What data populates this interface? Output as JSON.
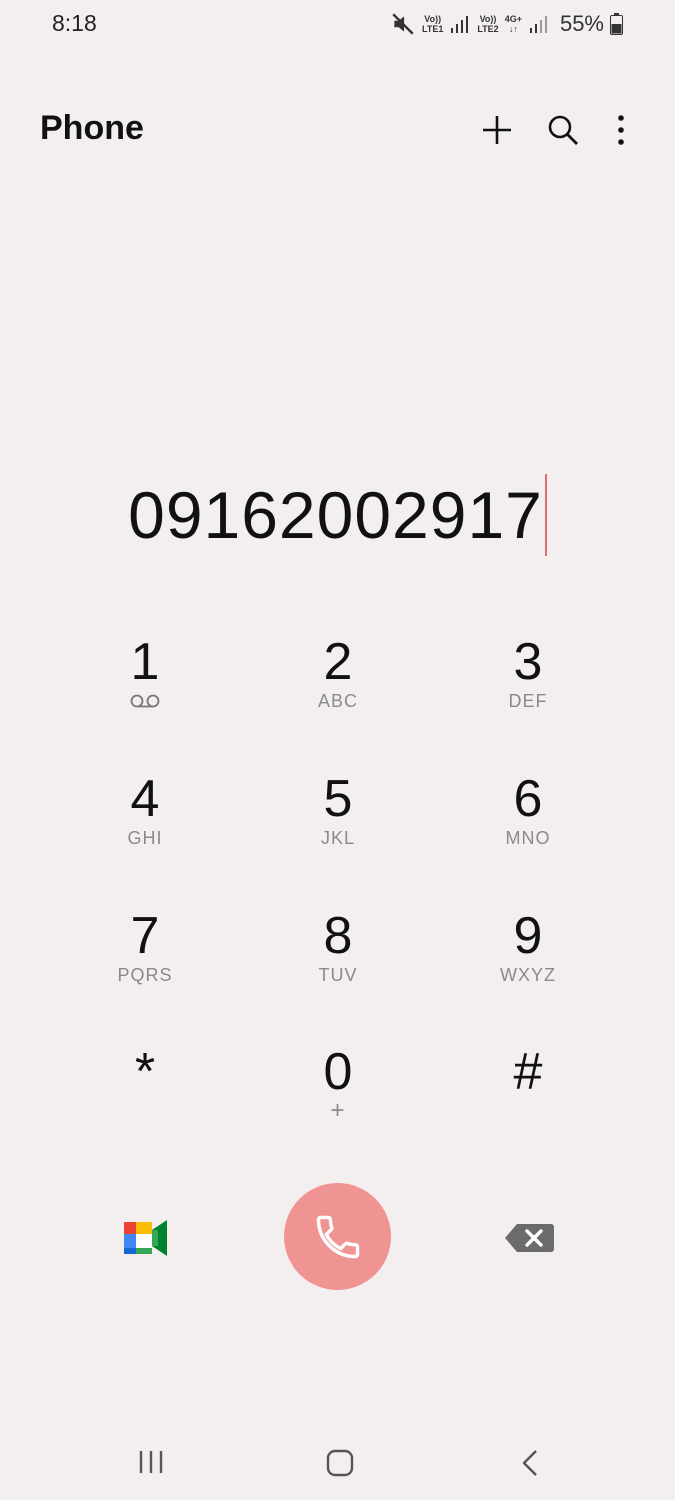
{
  "status_bar": {
    "time": "8:18",
    "sim1_top": "Vo))",
    "sim1_bottom": "LTE1",
    "sim2_top": "Vo))",
    "sim2_bottom": "LTE2",
    "network_type": "4G+",
    "battery": "55%"
  },
  "header": {
    "title": "Phone",
    "icons": [
      "add-icon",
      "search-icon",
      "more-vert-icon"
    ]
  },
  "dialer": {
    "entered_number": "09162002917"
  },
  "keypad": {
    "keys": [
      {
        "digit": "1",
        "letters": ""
      },
      {
        "digit": "2",
        "letters": "ABC"
      },
      {
        "digit": "3",
        "letters": "DEF"
      },
      {
        "digit": "4",
        "letters": "GHI"
      },
      {
        "digit": "5",
        "letters": "JKL"
      },
      {
        "digit": "6",
        "letters": "MNO"
      },
      {
        "digit": "7",
        "letters": "PQRS"
      },
      {
        "digit": "8",
        "letters": "TUV"
      },
      {
        "digit": "9",
        "letters": "WXYZ"
      },
      {
        "digit": "*",
        "letters": ""
      },
      {
        "digit": "0",
        "letters": "+"
      },
      {
        "digit": "#",
        "letters": ""
      }
    ]
  },
  "actions": {
    "icons": [
      "google-meet-icon",
      "call-icon",
      "backspace-icon"
    ],
    "call_color": "#f09393"
  },
  "colors": {
    "background": "#f3efef",
    "cursor": "#e07070"
  },
  "navbar": {
    "icons": [
      "recents-icon",
      "home-icon",
      "back-icon"
    ]
  }
}
